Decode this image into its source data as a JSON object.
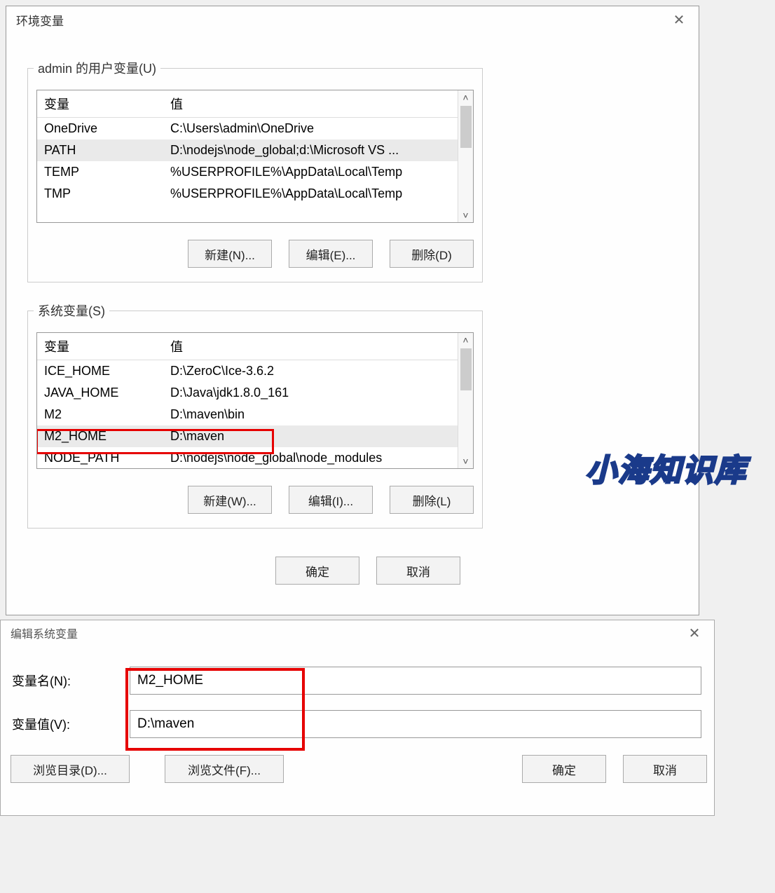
{
  "dialog1": {
    "title": "环境变量",
    "user_group_title": "admin 的用户变量(U)",
    "headers": {
      "variable": "变量",
      "value": "值"
    },
    "user_vars": [
      {
        "name": "OneDrive",
        "value": "C:\\Users\\admin\\OneDrive",
        "selected": false
      },
      {
        "name": "PATH",
        "value": "D:\\nodejs\\node_global;d:\\Microsoft VS ...",
        "selected": true
      },
      {
        "name": "TEMP",
        "value": "%USERPROFILE%\\AppData\\Local\\Temp",
        "selected": false
      },
      {
        "name": "TMP",
        "value": "%USERPROFILE%\\AppData\\Local\\Temp",
        "selected": false
      }
    ],
    "user_buttons": {
      "new": "新建(N)...",
      "edit": "编辑(E)...",
      "delete": "删除(D)"
    },
    "system_group_title": "系统变量(S)",
    "system_vars": [
      {
        "name": "ICE_HOME",
        "value": "D:\\ZeroC\\Ice-3.6.2",
        "selected": false
      },
      {
        "name": "JAVA_HOME",
        "value": "D:\\Java\\jdk1.8.0_161",
        "selected": false
      },
      {
        "name": "M2",
        "value": "D:\\maven\\bin",
        "selected": false
      },
      {
        "name": "M2_HOME",
        "value": "D:\\maven",
        "selected": true
      },
      {
        "name": "NODE_PATH",
        "value": "D:\\nodejs\\node_global\\node_modules",
        "selected": false
      }
    ],
    "system_buttons": {
      "new": "新建(W)...",
      "edit": "编辑(I)...",
      "delete": "删除(L)"
    },
    "bottom_buttons": {
      "ok": "确定",
      "cancel": "取消"
    }
  },
  "watermark_text": "小海知识库",
  "dialog2": {
    "title": "编辑系统变量",
    "name_label": "变量名(N):",
    "name_value": "M2_HOME",
    "value_label": "变量值(V):",
    "value_value": "D:\\maven",
    "buttons": {
      "browse_dir": "浏览目录(D)...",
      "browse_file": "浏览文件(F)...",
      "ok": "确定",
      "cancel": "取消"
    }
  }
}
